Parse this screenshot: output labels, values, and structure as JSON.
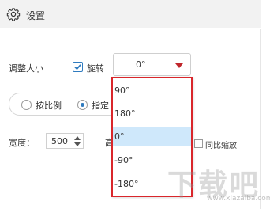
{
  "header": {
    "title": "设置",
    "icon": "gear-icon"
  },
  "resize": {
    "label": "调整大小"
  },
  "rotate": {
    "checkbox_checked": true,
    "label": "旋转",
    "selected_value": "0°",
    "arrow_color": "#c0262c"
  },
  "scale_mode": {
    "options": [
      {
        "label": "按比例",
        "checked": false
      },
      {
        "label": "指定",
        "checked": true
      }
    ]
  },
  "width": {
    "label": "宽度：",
    "value": "500"
  },
  "height": {
    "label": "高"
  },
  "proportional": {
    "label": "同比缩放",
    "checked": false
  },
  "rotation_dropdown": {
    "border_color": "#d9262b",
    "selected_index": 2,
    "options": [
      "90°",
      "180°",
      "0°",
      "-90°",
      "-180°"
    ]
  },
  "watermark": {
    "text": "下载吧",
    "url": "www.xiazaiba.com"
  }
}
